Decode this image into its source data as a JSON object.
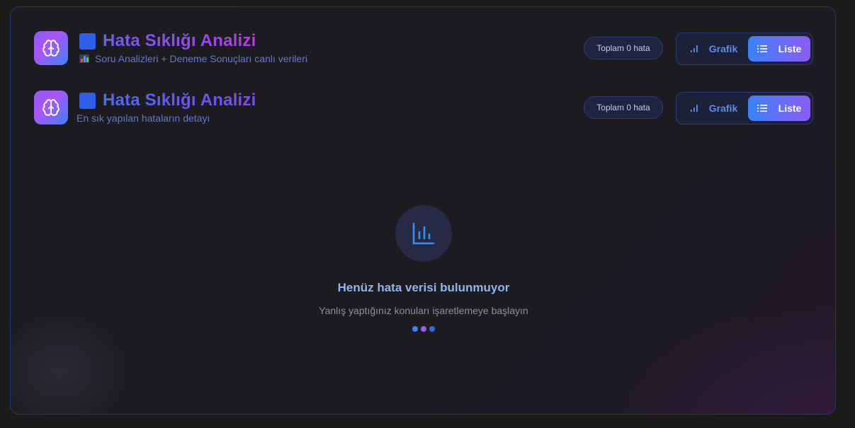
{
  "headers": [
    {
      "title": "Hata Sıklığı Analizi",
      "subtitle": "Soru Analizleri + Deneme Sonuçları canlı verileri",
      "total_badge": "Toplam 0 hata",
      "grafik_label": "Grafik",
      "liste_label": "Liste"
    },
    {
      "title": "Hata Sıklığı Analizi",
      "subtitle": "En sık yapılan hataların detayı",
      "total_badge": "Toplam 0 hata",
      "grafik_label": "Grafik",
      "liste_label": "Liste"
    }
  ],
  "empty_state": {
    "title": "Henüz hata verisi bulunmuyor",
    "subtitle": "Yanlış yaptığınız konuları işaretlemeye başlayın",
    "icon": "bar-chart-icon"
  },
  "colors": {
    "accent_blue": "#3b82f6",
    "accent_purple": "#8b5cf6",
    "dot_colors": [
      "#3b82f6",
      "#a855f7",
      "#2f6ae8"
    ]
  }
}
